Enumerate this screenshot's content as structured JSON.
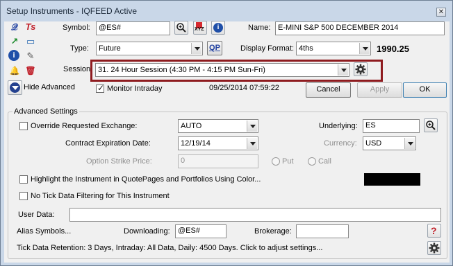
{
  "window": {
    "title": "Setup Instruments - IQFEED Active",
    "close_glyph": "✕"
  },
  "toolbar": {
    "chart_glyph": "𝓠",
    "ts_glyph": "Ts",
    "line_glyph": "↗",
    "tv_glyph": "▭",
    "info_glyph": "i",
    "scroll_glyph": "✎",
    "bell_glyph": "🔔",
    "trash_glyph": "🗑"
  },
  "symbol": {
    "label": "Symbol:",
    "value": "@ES#",
    "xyz_label": "XYZ",
    "info_glyph": "i"
  },
  "name": {
    "label": "Name:",
    "value": "E-MINI S&P 500 DECEMBER 2014"
  },
  "type": {
    "label": "Type:",
    "value": "Future",
    "qp_label": "QP"
  },
  "display_format": {
    "label": "Display Format:",
    "value": "4ths",
    "price": "1990.25"
  },
  "session": {
    "label": "Session:",
    "value": "31. 24 Hour Session (4:30 PM - 4:15 PM Sun-Fri)"
  },
  "hide_advanced": {
    "label": "Hide Advanced"
  },
  "monitor_intraday": {
    "label": "Monitor Intraday",
    "checked": true
  },
  "timestamp": "09/25/2014 07:59:22",
  "buttons": {
    "cancel": "Cancel",
    "apply": "Apply",
    "ok": "OK"
  },
  "advanced": {
    "title": "Advanced Settings",
    "override_exchange": {
      "label": "Override Requested Exchange:",
      "value": "AUTO"
    },
    "underlying": {
      "label": "Underlying:",
      "value": "ES"
    },
    "contract_expiration": {
      "label": "Contract Expiration Date:",
      "value": "12/19/14"
    },
    "currency": {
      "label": "Currency:",
      "value": "USD"
    },
    "option_strike": {
      "label": "Option Strike Price:",
      "value": "0",
      "put_label": "Put",
      "call_label": "Call"
    },
    "highlight": {
      "label": "Highlight the Instrument in QuotePages and Portfolios Using Color...",
      "color": "#000000"
    },
    "no_tick_filter": {
      "label": "No Tick Data Filtering for This Instrument"
    },
    "user_data": {
      "label": "User Data:",
      "value": ""
    },
    "alias_symbols": "Alias Symbols...",
    "downloading": {
      "label": "Downloading:",
      "value": "@ES#"
    },
    "brokerage": {
      "label": "Brokerage:",
      "value": ""
    },
    "help_glyph": "?",
    "retention_text": "Tick Data Retention: 3 Days, Intraday: All Data, Daily: 4500 Days. Click to adjust settings..."
  },
  "colors": {
    "highlight_box": "#8e1b1f",
    "accent_blue": "#1f4fa8",
    "titlebar": "#c9d7e8"
  }
}
